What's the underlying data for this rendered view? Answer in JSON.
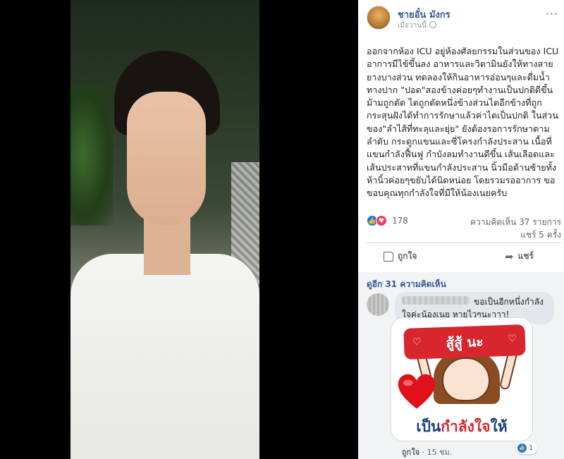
{
  "post": {
    "author": "ชายอั๋น มังกร",
    "time": "เมื่อวานนี้",
    "more_label": "···",
    "text": "ออกจากห้อง ICU อยู่ห้องศัลยกรรมในส่วนของ ICU อาการมีไข้ขึ้นลง อาหารและวิตามินยังให้ทางสายยางบางส่วน ทดลองให้กินอาหารอ่อนๆและดื่มน้ำทางปาก \"ปอด\"สองข้างค่อยๆทำงานเป็นปกติดีขึ้น ม้ามถูกตัด ไตถูกตัดหนึ่งข้างส่วนไตอีกข้างที่ถูกกระสุนฝังได้ทำการรักษาแล้วค่าไตเป็นปกติ ในส่วนของ\"ลำไส้ที่ทะลุและยุ่ย\" ยังต้องรอการรักษาตามลำดับ กระดูกแขนและซี่โครงกำลังประสาน เนื้อที่แขนกำลังฟื้นฟู กำบังลมทำงานดีขึ้น เส้นเลือดและเส้นประสาทที่แขนกำลังประสาน นิ้วมือด้านซ้ายทั้งห้านิ้วค่อยๆขยับได้นิดหน่อย โดยรวมรออาการ ขอขอบคุณทุกกำลังใจที่มีให้น้องเนยครับ"
  },
  "stats": {
    "reaction_count": "178",
    "comments": "ความคิดเห็น 37 รายการ",
    "shares": "แชร์ 5 ครั้ง"
  },
  "actions": {
    "like": "ถูกใจ",
    "share": "แชร์"
  },
  "comments": {
    "more": "ดูอีก 31 ความคิดเห็น",
    "item": {
      "text_line1": "ขอเป็นอีกหนึ่งกำลัง",
      "text_line2": "ใจค่ะน้องเนย หายไวๆนะาาา!",
      "sticker_top": "สู้สู้ นะ",
      "sticker_caption_a": "เป็น",
      "sticker_caption_b": "กำลังใจ",
      "sticker_caption_c": "ให้",
      "like": "ถูกใจ",
      "time": "15 ชม.",
      "like_count": "1"
    }
  },
  "colors": {
    "link": "#365899",
    "like_blue": "#1877f2",
    "love_red": "#f33e58"
  }
}
